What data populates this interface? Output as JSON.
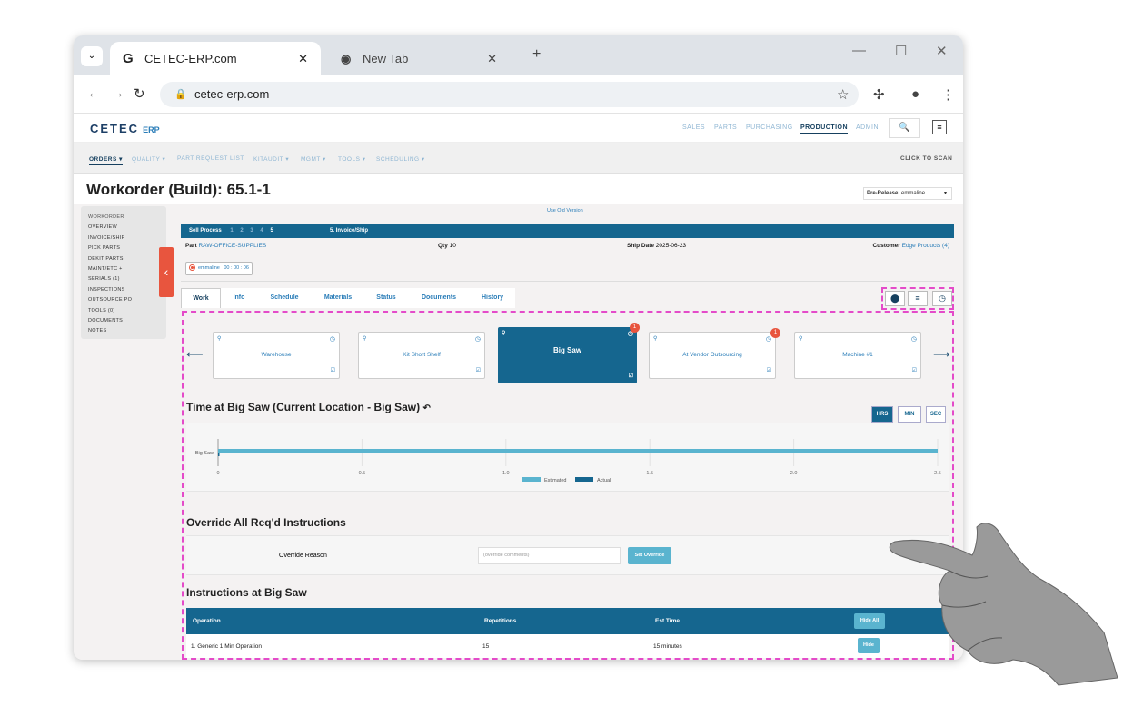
{
  "browser": {
    "tabs": [
      {
        "title": "CETEC-ERP.com",
        "favicon": "G"
      },
      {
        "title": "New Tab"
      }
    ],
    "url": "cetec-erp.com"
  },
  "app": {
    "logo": "CETEC",
    "logo_sub": "ERP",
    "top_nav": [
      "SALES",
      "PARTS",
      "PURCHASING",
      "PRODUCTION",
      "ADMIN"
    ],
    "active_top_nav": "PRODUCTION",
    "sub_nav": [
      "ORDERS ▾",
      "QUALITY ▾",
      "PART REQUEST LIST",
      "KITAUDIT ▾",
      "MGMT ▾",
      "TOOLS ▾",
      "SCHEDULING ▾"
    ],
    "click_to_scan": "CLICK TO SCAN"
  },
  "page": {
    "title": "Workorder (Build): 65.1-1",
    "prerelease_label": "Pre-Release:",
    "prerelease_value": "emmaline",
    "old_version": "Use Old Version"
  },
  "sidebar": [
    "WORKORDER",
    "OVERVIEW",
    "INVOICE/SHIP",
    "PICK PARTS",
    "DEKIT PARTS",
    "MAINT/ETC +",
    "SERIALS (1)",
    "INSPECTIONS",
    "OUTSOURCE PO",
    "TOOLS (0)",
    "DOCUMENTS",
    "NOTES"
  ],
  "process": {
    "label": "Sell Process",
    "steps": [
      "1",
      "2",
      "3",
      "4",
      "5"
    ],
    "current": "5. Invoice/Ship"
  },
  "info": {
    "part_label": "Part",
    "part_value": "RAW-OFFICE-SUPPLIES",
    "qty_label": "Qty",
    "qty_value": "10",
    "ship_label": "Ship Date",
    "ship_value": "2025-06-23",
    "customer_label": "Customer",
    "customer_value": "Edge Products (4)",
    "timer_user": "emmaline",
    "timer_value": "00 : 00 : 06"
  },
  "work_tabs": [
    "Work",
    "Info",
    "Schedule",
    "Materials",
    "Status",
    "Documents",
    "History"
  ],
  "locations": [
    {
      "name": "Warehouse"
    },
    {
      "name": "Kit Short Shelf"
    },
    {
      "name": "Big Saw",
      "badge": "1"
    },
    {
      "name": "At Vendor Outsourcing",
      "badge": "1"
    },
    {
      "name": "Machine #1"
    }
  ],
  "time_section": {
    "title": "Time at Big Saw (Current Location - Big Saw)",
    "units": [
      "HRS",
      "MIN",
      "SEC"
    ],
    "active_unit": "HRS"
  },
  "chart_data": {
    "type": "bar",
    "orientation": "horizontal",
    "categories": [
      "Big Saw"
    ],
    "series": [
      {
        "name": "Estimated",
        "values": [
          2.5
        ],
        "color": "#5ab4cf"
      },
      {
        "name": "Actual",
        "values": [
          0.002
        ],
        "color": "#15668f"
      }
    ],
    "x_ticks": [
      "0",
      "0.5",
      "1.0",
      "1.5",
      "2.0",
      "2.5"
    ],
    "xlim": [
      0,
      2.5
    ],
    "legend": "bottom",
    "grid": true
  },
  "override": {
    "title": "Override All Req'd Instructions",
    "reason_label": "Override Reason",
    "placeholder": "(override comments)",
    "button": "Set Override"
  },
  "instructions": {
    "title": "Instructions at Big Saw",
    "headers": [
      "Operation",
      "Repetitions",
      "Est Time"
    ],
    "hide_all": "Hide All",
    "rows": [
      {
        "operation": "1. Generic 1 Min Operation",
        "repetitions": "15",
        "est_time": "15 minutes",
        "action": "Hide"
      }
    ]
  }
}
